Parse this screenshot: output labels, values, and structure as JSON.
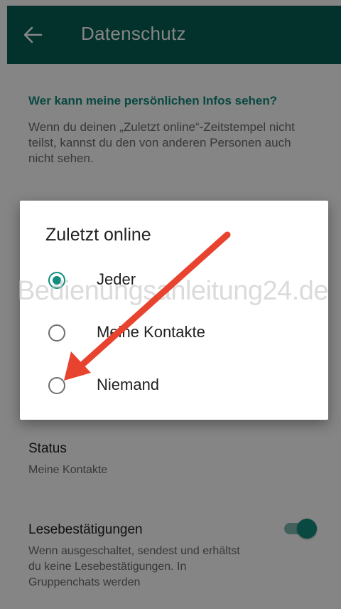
{
  "appbar": {
    "title": "Datenschutz",
    "back_icon": "arrow-back-icon",
    "background": "#075e54"
  },
  "privacy": {
    "section_header": "Wer kann meine persönlichen Infos sehen?",
    "section_description": "Wenn du deinen „Zuletzt online“-Zeitstempel nicht teilst, kannst du den von anderen Personen auch nicht sehen."
  },
  "settings": {
    "status": {
      "title": "Status",
      "value": "Meine Kontakte"
    },
    "read_receipts": {
      "title": "Lesebestätigungen",
      "description": "Wenn ausgeschaltet, sendest und erhältst du keine Lesebestätigungen. In Gruppenchats werden",
      "enabled": true
    }
  },
  "dialog": {
    "title": "Zuletzt online",
    "options": [
      {
        "label": "Jeder",
        "selected": true
      },
      {
        "label": "Meine Kontakte",
        "selected": false
      },
      {
        "label": "Niemand",
        "selected": false
      }
    ]
  },
  "watermark": "Bedienungsanleitung24.de",
  "colors": {
    "accent": "#128c7e",
    "arrow": "#e8432f",
    "scrim": "rgba(0,0,0,0.48)"
  }
}
